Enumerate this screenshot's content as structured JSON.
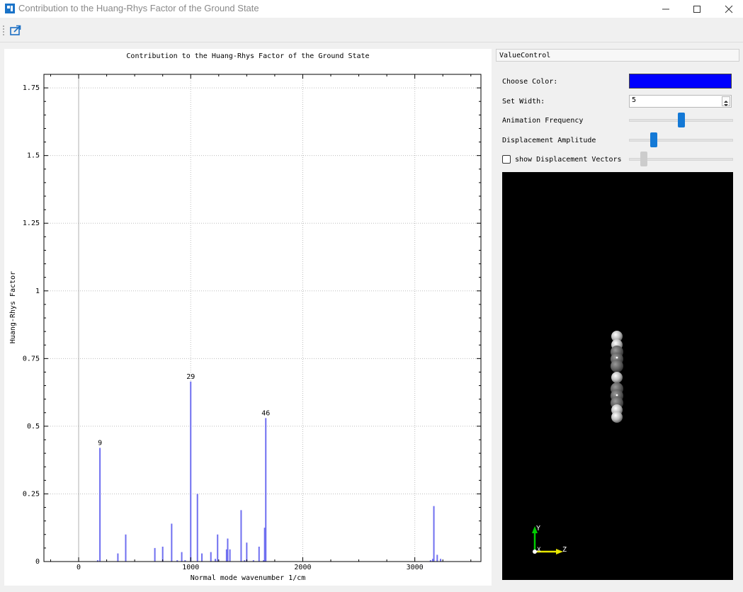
{
  "window": {
    "title": "Contribution to the Huang-Rhys Factor of the Ground State",
    "icon": "app-logo-icon",
    "controls": [
      "minimize-icon",
      "maximize-icon",
      "close-icon"
    ]
  },
  "toolbar": {
    "export_icon": "export-icon"
  },
  "plot": {
    "title": "Contribution to the Huang-Rhys Factor of the Ground State"
  },
  "chart_data": {
    "type": "bar",
    "title": "Contribution to the Huang-Rhys Factor of the Ground State",
    "xlabel": "Normal mode wavenumber 1/cm",
    "ylabel": "Huang-Rhys Factor",
    "xlim": [
      -310,
      3590
    ],
    "ylim": [
      0,
      1.8
    ],
    "xticks": [
      0,
      1000,
      2000,
      3000
    ],
    "yticks": [
      0,
      0.25,
      0.5,
      0.75,
      1,
      1.25,
      1.5,
      1.75
    ],
    "ytick_labels": [
      "0",
      "0.25",
      "0.5",
      "0.75",
      "1",
      "1.25",
      "1.5",
      "1.75"
    ],
    "grid": true,
    "bar_color": "#6f6ff0",
    "x": [
      170,
      190,
      350,
      420,
      680,
      750,
      830,
      880,
      920,
      950,
      1000,
      1060,
      1100,
      1180,
      1220,
      1240,
      1320,
      1330,
      1350,
      1450,
      1480,
      1500,
      1560,
      1610,
      1650,
      1660,
      1670,
      3140,
      3160,
      3170,
      3200,
      3230
    ],
    "values": [
      0.005,
      0.42,
      0.03,
      0.1,
      0.05,
      0.055,
      0.14,
      0.005,
      0.035,
      0.005,
      0.665,
      0.25,
      0.03,
      0.035,
      0.01,
      0.1,
      0.045,
      0.085,
      0.045,
      0.19,
      0.005,
      0.07,
      0.005,
      0.055,
      0.005,
      0.125,
      0.53,
      0.005,
      0.01,
      0.205,
      0.025,
      0.01
    ],
    "annotations": [
      {
        "label": "9",
        "x": 190,
        "y": 0.42
      },
      {
        "label": "29",
        "x": 1000,
        "y": 0.665
      },
      {
        "label": "46",
        "x": 1670,
        "y": 0.53
      }
    ]
  },
  "controls": {
    "header": "ValueControl",
    "choose_color_label": "Choose Color:",
    "color_value": "#0000ff",
    "set_width_label": "Set Width:",
    "width_value": "5",
    "animation_frequency_label": "Animation Frequency",
    "animation_frequency_level": 0.5,
    "displacement_amplitude_label": "Displacement Amplitude",
    "displacement_amplitude_level": 0.22,
    "show_vectors_label": "show Displacement Vectors",
    "show_vectors_checked": false,
    "vector_scale_level": 0.12
  },
  "viewer": {
    "axes": {
      "y": "Y",
      "x": "X",
      "z": "Z"
    },
    "axis_colors": {
      "x": "#ffffff",
      "y": "#00cc00",
      "z": "#e8e800"
    }
  }
}
